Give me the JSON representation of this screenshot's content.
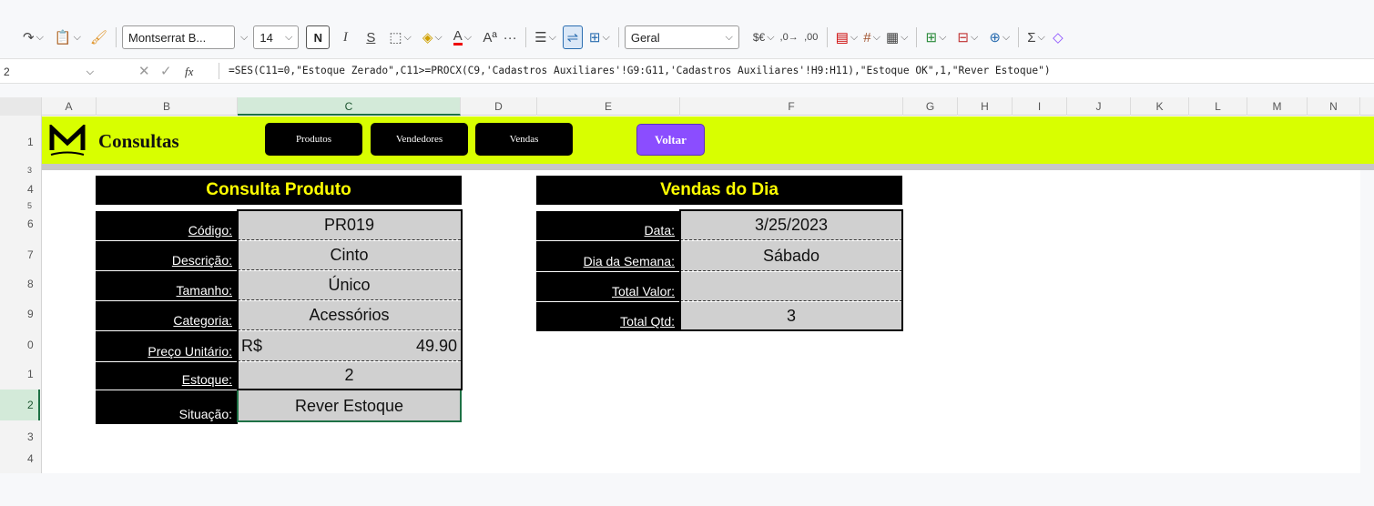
{
  "toolbar": {
    "font_name": "Montserrat B...",
    "font_size": "14",
    "bold": "N",
    "italic": "I",
    "strike": "S",
    "superscript": "Aª",
    "more": "···",
    "number_format": "Geral",
    "currency": "$€",
    "sum": "Σ"
  },
  "formula_bar": {
    "name_box": "2",
    "fx": "fx",
    "formula": "=SES(C11=0,\"Estoque Zerado\",C11>=PROCX(C9,'Cadastros Auxiliares'!G9:G11,'Cadastros Auxiliares'!H9:H11),\"Estoque OK\",1,\"Rever Estoque\")"
  },
  "columns": [
    "A",
    "B",
    "C",
    "D",
    "E",
    "F",
    "G",
    "H",
    "I",
    "J",
    "K",
    "L",
    "M",
    "N"
  ],
  "rows": [
    "1",
    "3",
    "4",
    "5",
    "6",
    "7",
    "8",
    "9",
    "0",
    "1",
    "2",
    "3",
    "4"
  ],
  "banner": {
    "title": "Consultas",
    "nav": [
      "Produtos",
      "Vendedores",
      "Vendas"
    ],
    "back": "Voltar"
  },
  "produto": {
    "title": "Consulta Produto",
    "fields": [
      {
        "label": "Código:",
        "value": "PR019"
      },
      {
        "label": "Descrição:",
        "value": "Cinto"
      },
      {
        "label": "Tamanho:",
        "value": "Único"
      },
      {
        "label": "Categoria:",
        "value": "Acessórios"
      },
      {
        "label": "Preço Unitário:",
        "currency": "R$",
        "value": "49.90"
      },
      {
        "label": "Estoque:",
        "value": "2"
      },
      {
        "label": "Situação:",
        "value": "Rever Estoque"
      }
    ]
  },
  "vendas": {
    "title": "Vendas do Dia",
    "fields": [
      {
        "label": "Data:",
        "value": "3/25/2023"
      },
      {
        "label": "Dia da Semana:",
        "value": "Sábado"
      },
      {
        "label": "Total Valor:",
        "value": ""
      },
      {
        "label": "Total Qtd:",
        "value": "3"
      }
    ]
  },
  "colors": {
    "banner": "#d8ff00",
    "voltar": "#8b4dff",
    "title_text": "#ffff00",
    "selection": "#1e7145"
  }
}
